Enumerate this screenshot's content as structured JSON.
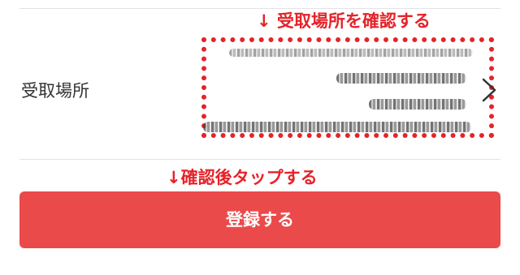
{
  "annotations": {
    "top": "↓ 受取場所を確認する",
    "button": "↓確認後タップする"
  },
  "pickup_row": {
    "label": "受取場所",
    "address_lines": [
      "",
      "",
      "",
      ""
    ],
    "chevron_icon": "chevron-right-icon"
  },
  "register_button": {
    "label": "登録する"
  },
  "colors": {
    "accent_red": "#e52329",
    "button_red": "#eb4a4b",
    "divider": "#e3e3e3"
  }
}
